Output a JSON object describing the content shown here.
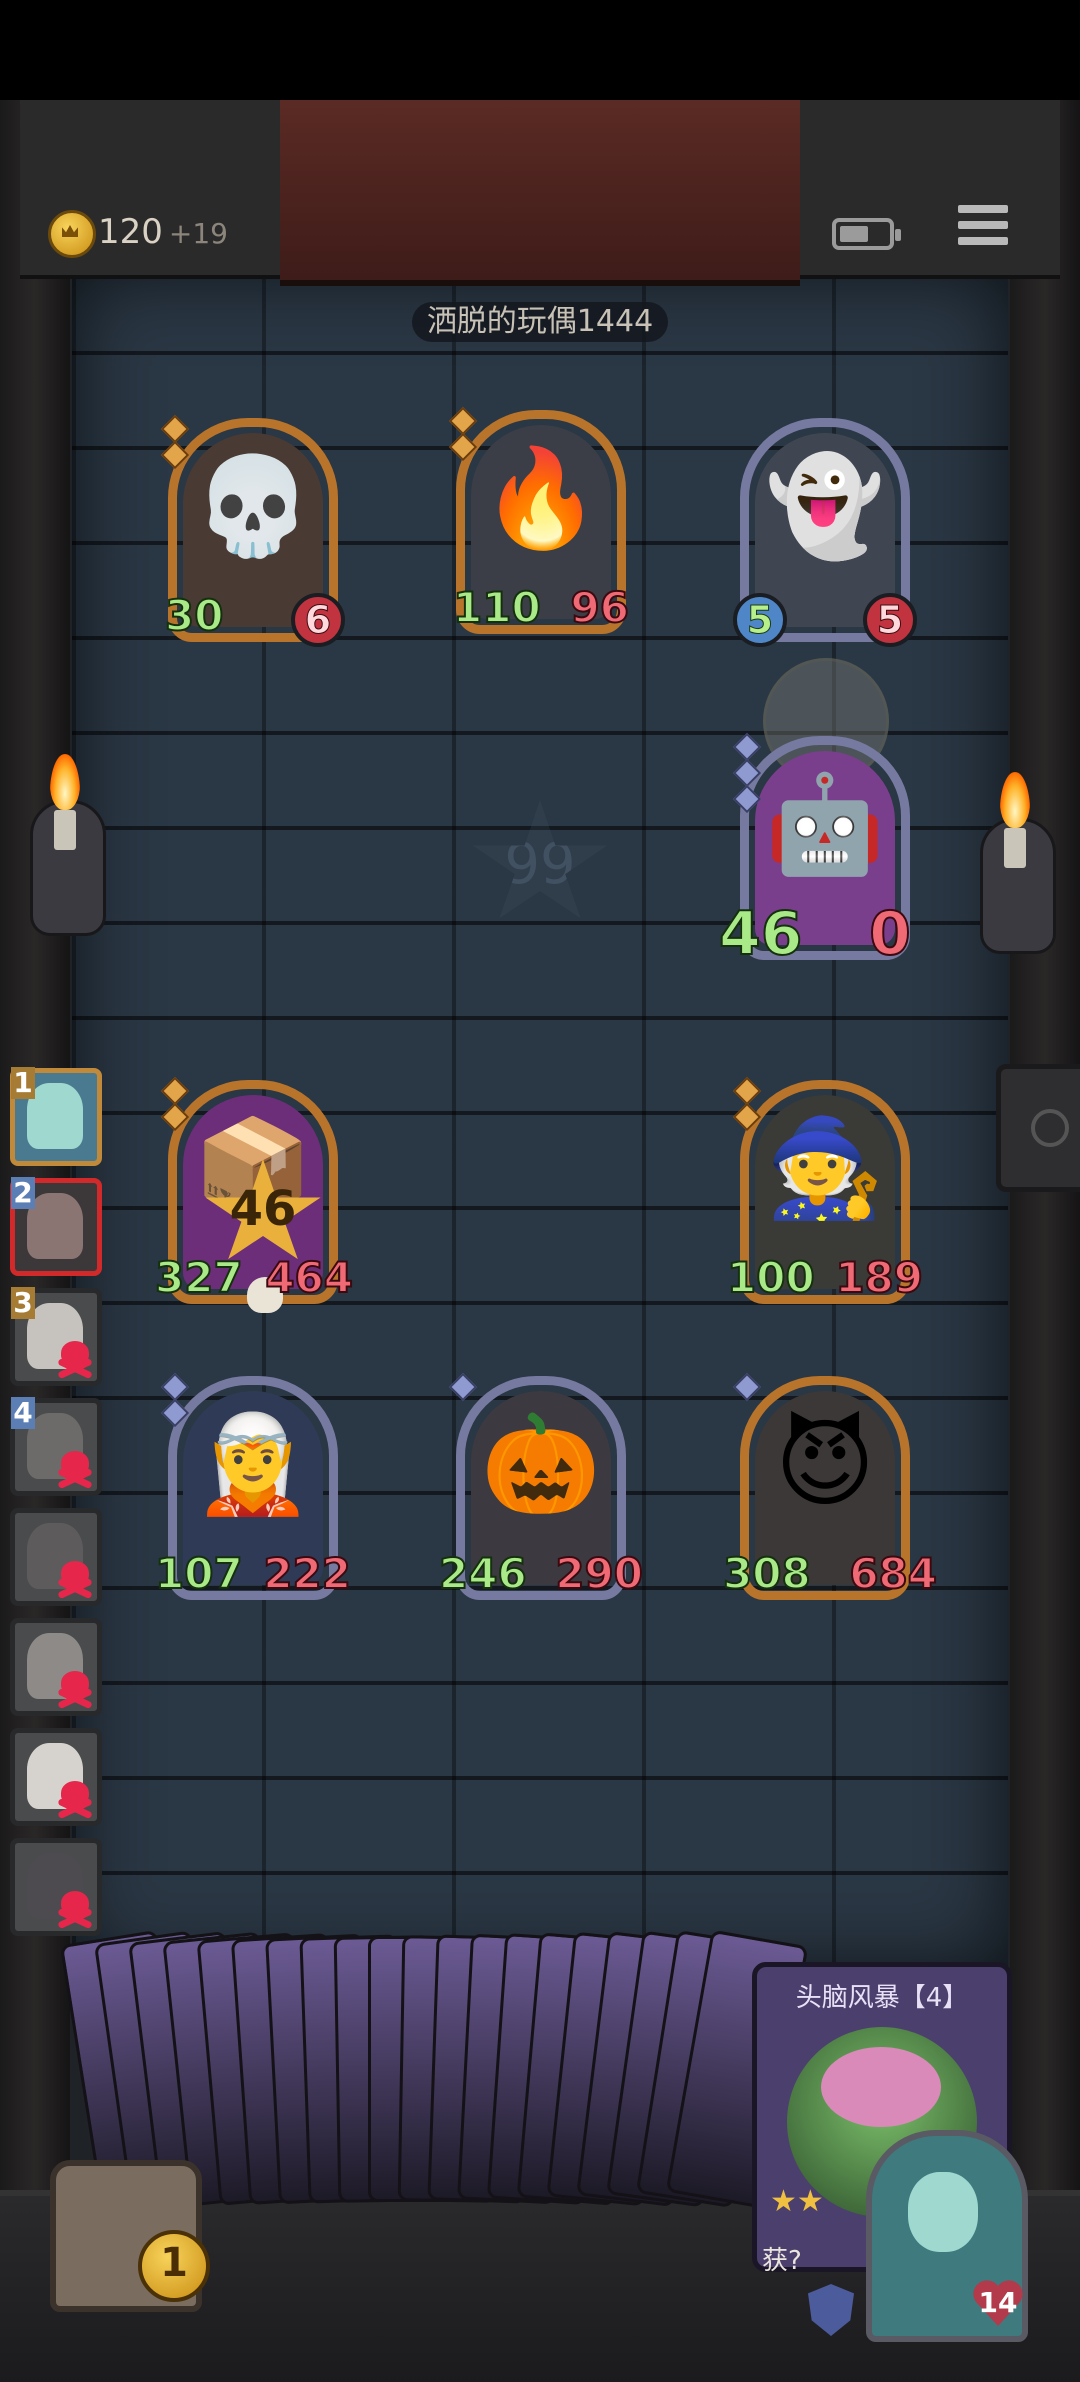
{
  "header": {
    "gold": "120",
    "gold_income": "+19",
    "player_name": "洒脱的玩偶1444"
  },
  "board": {
    "cards": [
      {
        "id": "c1",
        "emoji": "💀",
        "atk": "30",
        "hp": "6",
        "frame": "gold",
        "art": "#4a3a34"
      },
      {
        "id": "c2",
        "emoji": "🔥",
        "atk": "110",
        "hp": "96",
        "frame": "gold",
        "art": "#3b3e46"
      },
      {
        "id": "c3",
        "emoji": "👻",
        "atk": "5",
        "hp": "5",
        "frame": "gray",
        "art": "#3f4652"
      },
      {
        "id": "c4",
        "emoji": "🤖",
        "atk": "46",
        "hp": "0",
        "frame": "gray",
        "art": "#7a3f8c"
      },
      {
        "id": "c5",
        "emoji": "📦",
        "atk": "327",
        "hp": "464",
        "frame": "gold",
        "art": "#6c2e78",
        "star": "46"
      },
      {
        "id": "c6",
        "emoji": "🧙",
        "atk": "100",
        "hp": "189",
        "frame": "gold",
        "art": "#3a3a36"
      },
      {
        "id": "c7",
        "emoji": "🧝",
        "atk": "107",
        "hp": "222",
        "frame": "gray",
        "art": "#2f3a56"
      },
      {
        "id": "c8",
        "emoji": "🎃",
        "atk": "246",
        "hp": "290",
        "frame": "gray",
        "art": "#3c3a40"
      },
      {
        "id": "c9",
        "emoji": "😈",
        "atk": "308",
        "hp": "684",
        "frame": "gold",
        "art": "#3c3837"
      }
    ],
    "faded_star_value": "99"
  },
  "queue": [
    {
      "num": "1",
      "state": "first"
    },
    {
      "num": "2",
      "state": "current"
    },
    {
      "num": "3",
      "state": "dead"
    },
    {
      "num": "4",
      "state": "dead"
    },
    {
      "num": "",
      "state": "dead"
    },
    {
      "num": "",
      "state": "dead"
    },
    {
      "num": "",
      "state": "dead"
    },
    {
      "num": "",
      "state": "dead"
    }
  ],
  "hand": {
    "featured_title": "头脑风暴【4】",
    "featured_stars": "★★",
    "acquire_label": "获?"
  },
  "bottom": {
    "chest_count": "1",
    "hero_hp": "14"
  },
  "colors": {
    "wall": "#2a3744",
    "gold_frame": "#b8742a",
    "gray_frame": "#767aa0",
    "attack_text": "#a9e987",
    "health_text": "#f06a76"
  },
  "icons": [
    "coin-icon",
    "battery-icon",
    "menu-icon",
    "skull-icon",
    "shield-icon",
    "heart-icon",
    "torch-icon"
  ]
}
